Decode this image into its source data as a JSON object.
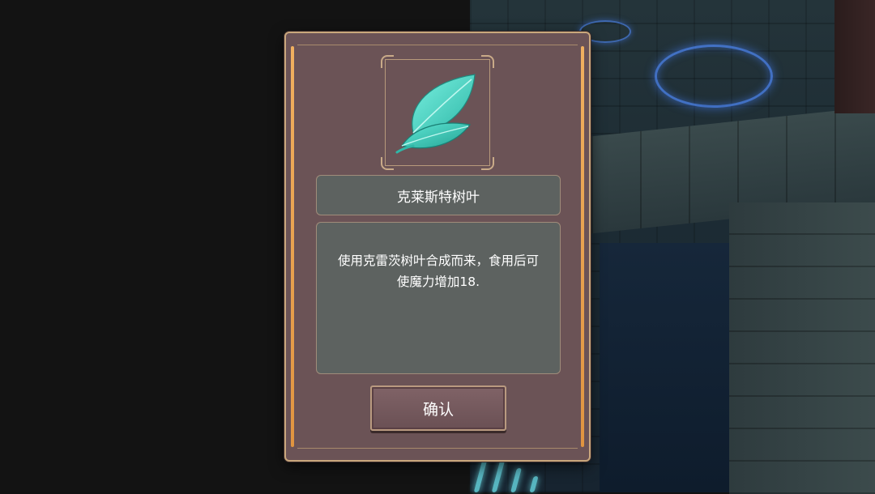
{
  "dialog": {
    "item_name": "克莱斯特树叶",
    "description": "使用克雷茨树叶合成而来，食用后可使魔力增加18.",
    "confirm_label": "确认",
    "icon": "teal-leaf-icon"
  },
  "colors": {
    "panel": "#6b5356",
    "panel_border": "#c9a77c",
    "accent_bar": "#e8a24c",
    "text_box": "#5d6260",
    "leaf": "#4fd8c4"
  }
}
